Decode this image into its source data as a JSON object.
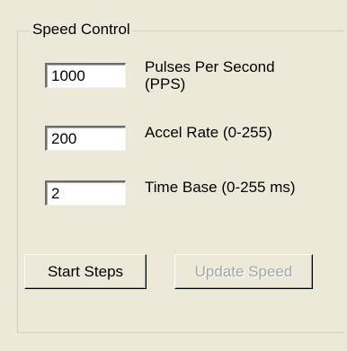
{
  "speed_control": {
    "title": "Speed Control",
    "fields": [
      {
        "value": "1000",
        "label_line1": "Pulses Per Second",
        "label_line2": "(PPS)"
      },
      {
        "value": "200",
        "label": "Accel Rate (0-255)"
      },
      {
        "value": "2",
        "label": "Time Base (0-255 ms)"
      }
    ],
    "buttons": {
      "start_steps": "Start Steps",
      "update_speed": "Update Speed",
      "update_speed_enabled": false
    }
  }
}
